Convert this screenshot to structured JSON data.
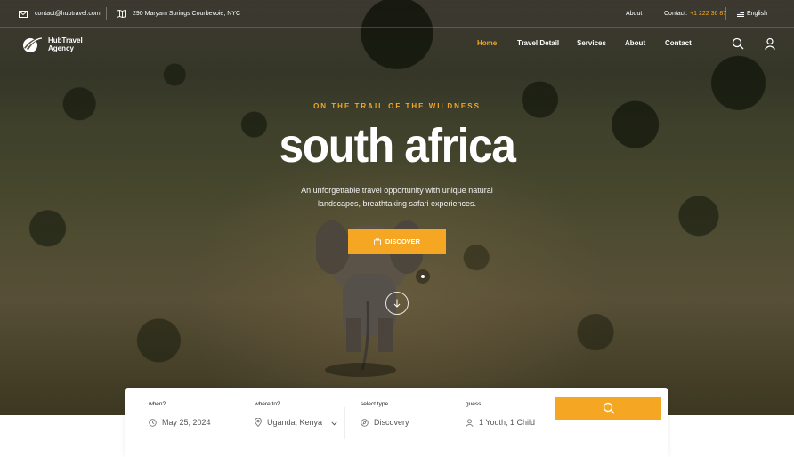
{
  "topbar": {
    "email": "contact@hubtravel.com",
    "address": "290 Maryam Springs Courbevoie, NYC",
    "about": "About",
    "contact_prefix": "Contact:",
    "contact_phone": "+1 222 36 87",
    "language": "English"
  },
  "brand": {
    "line1": "HubTravel",
    "line2": "Agency"
  },
  "nav": {
    "items": [
      {
        "label": "Home",
        "active": true
      },
      {
        "label": "Travel Detail",
        "active": false
      },
      {
        "label": "Services",
        "active": false
      },
      {
        "label": "About",
        "active": false
      },
      {
        "label": "Contact",
        "active": false
      }
    ],
    "search_icon": "search-icon",
    "user_icon": "user-icon"
  },
  "hero": {
    "eyebrow": "ON THE TRAIL OF THE WILDNESS",
    "title": "south africa",
    "description": "An unforgettable travel opportunity with unique natural landscapes, breathtaking safari experiences.",
    "cta_label": "DISCOVER"
  },
  "search": {
    "when_label": "when?",
    "when_value": "May 25, 2024",
    "where_label": "where to?",
    "where_value": "Uganda, Kenya",
    "type_label": "select type",
    "type_value": "Discovery",
    "guests_label": "guess",
    "guests_value": "1 Youth, 1 Child"
  },
  "colors": {
    "accent": "#f5a623",
    "text_light": "#ffffff"
  }
}
